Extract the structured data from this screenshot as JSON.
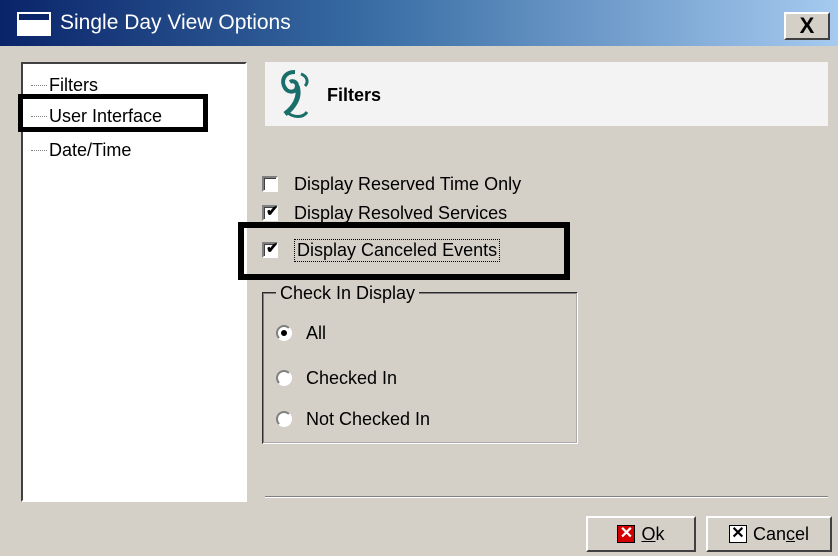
{
  "window": {
    "title": "Single Day View Options",
    "close_label": "X"
  },
  "tree": {
    "items": [
      {
        "label": "Filters"
      },
      {
        "label": "User Interface"
      },
      {
        "label": "Date/Time"
      }
    ]
  },
  "header": {
    "title": "Filters",
    "icon": "app-logo-icon"
  },
  "checkboxes": [
    {
      "label": "Display Reserved Time Only",
      "checked": false
    },
    {
      "label": "Display Resolved Services",
      "checked": true
    },
    {
      "label": "Display Canceled Events",
      "checked": true
    }
  ],
  "check_in_group": {
    "title": "Check In Display",
    "options": [
      {
        "label": "All",
        "selected": true
      },
      {
        "label": "Checked In",
        "selected": false
      },
      {
        "label": "Not Checked In",
        "selected": false
      }
    ]
  },
  "buttons": {
    "ok": {
      "accel": "O",
      "rest": "k",
      "icon": "x-icon"
    },
    "cancel": {
      "pre": "Can",
      "accel": "c",
      "rest": "el",
      "icon": "x-icon"
    }
  },
  "colors": {
    "titlebar_start": "#0a246a",
    "titlebar_end": "#a6caf0",
    "face": "#d4d0c8",
    "ok_icon": "#d40000"
  },
  "checkmark_glyph": "✔"
}
